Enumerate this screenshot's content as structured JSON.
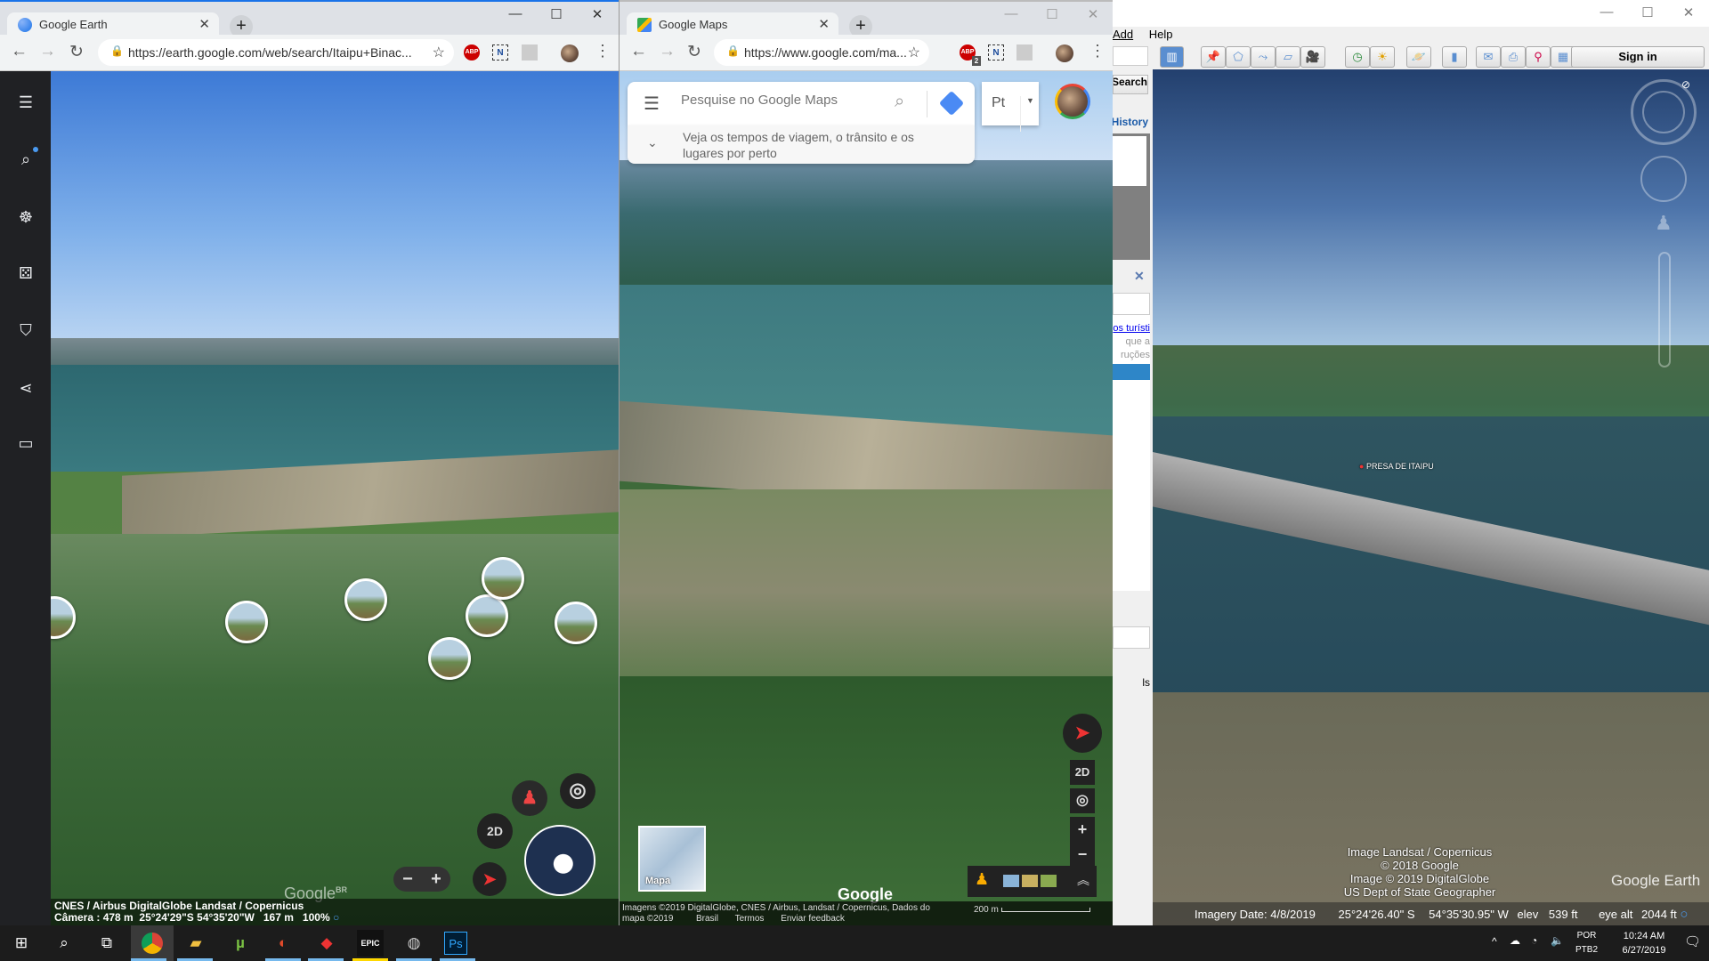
{
  "earth_window": {
    "tab_title": "Google Earth",
    "url": "https://earth.google.com/web/search/Itaipu+Binac...",
    "attribution": "CNES / Airbus DigitalGlobe Landsat / Copernicus",
    "camera_label": "Câmera :",
    "camera_alt": "478 m",
    "lat": "25°24'29\"S",
    "lon": "54°35'20\"W",
    "elevation": "167 m",
    "load": "100%",
    "logo": "Google",
    "logo_region": "BR",
    "sidebar": [
      "menu-icon",
      "search-icon",
      "voyager-icon",
      "feeling-lucky-icon",
      "bookmark-icon",
      "share-icon",
      "ruler-icon"
    ],
    "btn_2d": "2D",
    "zoom_minus": "−",
    "zoom_plus": "+"
  },
  "maps_window": {
    "tab_title": "Google Maps",
    "url": "https://www.google.com/ma...",
    "abp_count": "2",
    "search_placeholder": "Pesquise no Google Maps",
    "suggestion": "Veja os tempos de viagem, o trânsito e os lugares por perto",
    "lang": "Pt",
    "thumb_label": "Mapa",
    "logo": "Google",
    "attribution": "Imagens ©2019 DigitalGlobe, CNES / Airbus, Landsat / Copernicus, Dados do mapa ©2019",
    "links": [
      "Brasil",
      "Termos",
      "Enviar feedback"
    ],
    "scale": "200 m",
    "btn_2d": "2D",
    "zoom_plus": "+",
    "zoom_minus": "−"
  },
  "earth_pro": {
    "menu": [
      "Add",
      "Help"
    ],
    "search_btn": "Search",
    "history": "History",
    "panel_link": "os turísti",
    "panel_text1": "que a",
    "panel_text2": "ruções",
    "panel_text3": "ls",
    "sign_in": "Sign in",
    "placemark_label": "PRESA DE ITAIPU",
    "credits": [
      "Image Landsat / Copernicus",
      "© 2018 Google",
      "Image © 2019 DigitalGlobe",
      "US Dept of State Geographer"
    ],
    "logo": "Google Earth",
    "imagery_date_label": "Imagery Date:",
    "imagery_date": "4/8/2019",
    "lat": "25°24'26.40\" S",
    "lon": "54°35'30.95\" W",
    "elev_label": "elev",
    "elev": "539 ft",
    "eye_label": "eye alt",
    "eye_alt": "2044 ft"
  },
  "taskbar": {
    "lang1": "POR",
    "lang2": "PTB2",
    "time": "10:24 AM",
    "date": "6/27/2019"
  },
  "colors": {
    "accent": "#1a73e8",
    "taskbar": "#1c1c1c",
    "earth_sidebar": "#202124"
  }
}
